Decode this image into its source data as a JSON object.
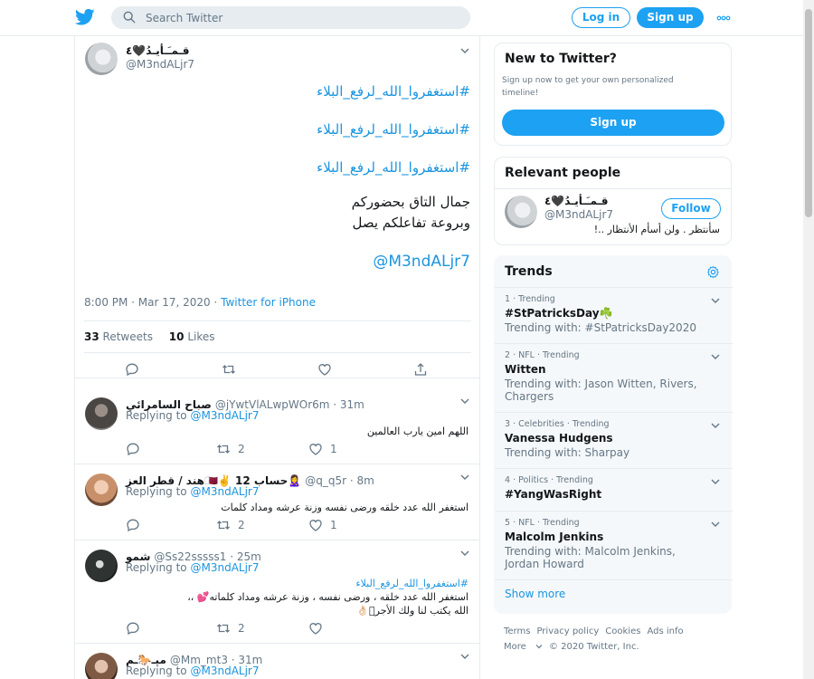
{
  "header": {
    "search_placeholder": "Search Twitter",
    "login_label": "Log in",
    "signup_label": "Sign up",
    "more_icon": "more-dots-icon",
    "brand_color": "#1da1f2"
  },
  "main_tweet": {
    "author_name": "قـمـَـأيـدُ🖤٤",
    "author_handle": "@M3ndALjr7",
    "hashtag_lines": [
      "#استغفروا_الله_لرفع_البلاء",
      "#استغفروا_الله_لرفع_البلاء",
      "#استغفروا_الله_لرفع_البلاء"
    ],
    "text_lines": [
      "جمال التاق بحضوركم",
      "وبروعة تفاعلكم يصل"
    ],
    "mention": "@M3ndALjr7",
    "time": "8:00 PM · Mar 17, 2020 · ",
    "source": "Twitter for iPhone",
    "retweets_count": "33",
    "retweets_label": "Retweets",
    "likes_count": "10",
    "likes_label": "Likes"
  },
  "replies": [
    {
      "name": "صباح السامرائي",
      "handle": "@jYwtVlALwpWOr6m · 31m",
      "replying_label": "Replying to",
      "replying_to": "@M3ndALjr7",
      "hashtag": "",
      "text_lines": [
        "اللهم امين يارب العالمين"
      ],
      "retweets": "2",
      "likes": "1"
    },
    {
      "name": "هند / قطر العز🇶🇦✌️ حساب 12🙎‍♀️",
      "handle": "@q_q5r · 8m",
      "replying_label": "Replying to",
      "replying_to": "@M3ndALjr7",
      "hashtag": "",
      "text_lines": [
        "استغفر الله عدد خلقه ورضى نفسه وزنة عرشه ومداد كلمات"
      ],
      "retweets": "2",
      "likes": "1"
    },
    {
      "name": "شمو",
      "handle": "@Ss22sssss1 · 25m",
      "replying_label": "Replying to",
      "replying_to": "@M3ndALjr7",
      "hashtag": "#استغفروا_الله_لرفع_البلاء",
      "text_lines": [
        "استغفر الله عدد خلقه ، ورضى نفسه ، وزنة عرشه ومداد كلماته💕 ،،",
        "الله يكتب لنا ولك الأجر🏻👌🏻"
      ],
      "retweets": "2",
      "likes": ""
    },
    {
      "name": "ميـ🐎ـم",
      "handle": "@Mm_mt3 · 31m",
      "replying_label": "Replying to",
      "replying_to": "@M3ndALjr7",
      "hashtag": "",
      "text_lines": [],
      "retweets": "",
      "likes": ""
    }
  ],
  "new_to_twitter": {
    "title": "New to Twitter?",
    "desc": "Sign up now to get your own personalized timeline!",
    "signup_label": "Sign up"
  },
  "relevant_people": {
    "title": "Relevant people",
    "name": "قـمـَـأيـدُ🖤٤",
    "handle": "@M3ndALjr7",
    "follow_label": "Follow",
    "bio": "سأنتظر . ولن أسأم الأنتظار ..!"
  },
  "trends": {
    "title": "Trends",
    "items": [
      {
        "meta": "1 · Trending",
        "title": "#StPatricksDay☘️",
        "sub": "Trending with: #StPatricksDay2020"
      },
      {
        "meta": "2 · NFL · Trending",
        "title": "Witten",
        "sub": "Trending with: Jason Witten, Rivers, Chargers"
      },
      {
        "meta": "3 · Celebrities · Trending",
        "title": "Vanessa Hudgens",
        "sub": "Trending with: Sharpay"
      },
      {
        "meta": "4 · Politics · Trending",
        "title": "#YangWasRight",
        "sub": ""
      },
      {
        "meta": "5 · NFL · Trending",
        "title": "Malcolm Jenkins",
        "sub": "Trending with: Malcolm Jenkins, Jordan Howard"
      }
    ],
    "show_more": "Show more"
  },
  "footer": {
    "links": [
      "Terms",
      "Privacy policy",
      "Cookies",
      "Ads info"
    ],
    "more_label": "More",
    "copyright": "© 2020 Twitter, Inc."
  }
}
